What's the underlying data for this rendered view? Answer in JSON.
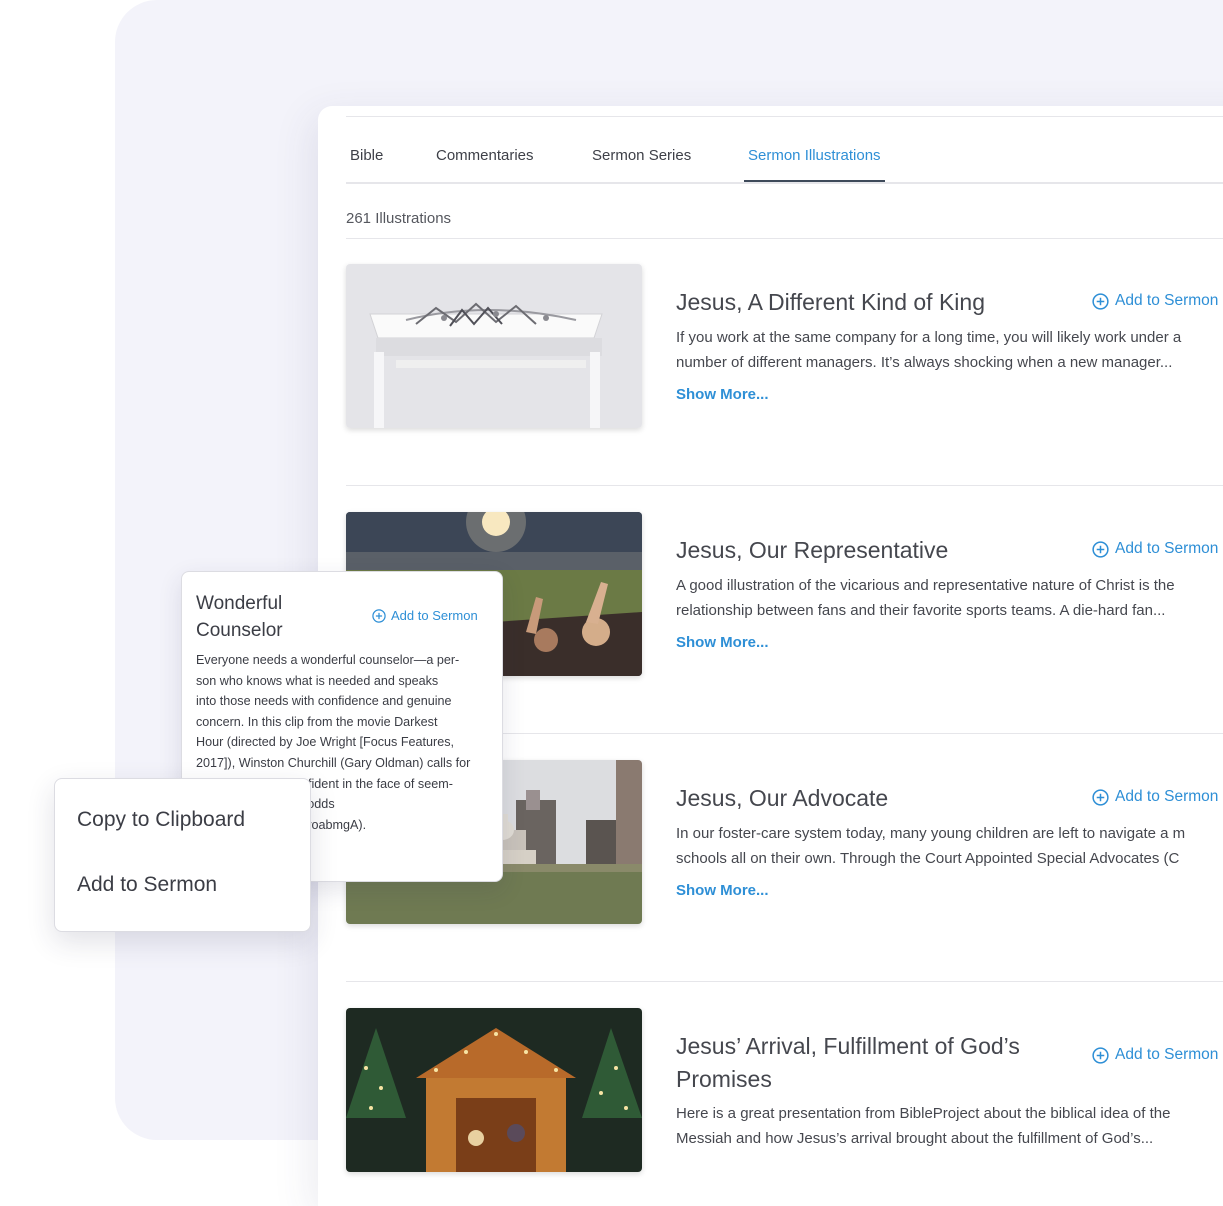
{
  "tabs": [
    {
      "label": "Bible"
    },
    {
      "label": "Commentaries"
    },
    {
      "label": "Sermon Series"
    },
    {
      "label": "Sermon Illustrations",
      "active": true
    }
  ],
  "count_label": "261 Illustrations",
  "colors": {
    "accent": "#2e8fd6",
    "text": "#45474e",
    "background_panel": "#f3f3fa"
  },
  "items": [
    {
      "title": "Jesus, A Different Kind of King",
      "add_label": "Add to Sermon",
      "desc_line1": "If you work at the same company for a long time, you will likely work under a",
      "desc_line2": "number of different managers. It’s always shocking when a new manager...",
      "more": "Show More...",
      "image": "crown-on-white-stand"
    },
    {
      "title": "Jesus, Our Representative",
      "add_label": "Add to Sermon",
      "desc_line1": "A good illustration of the vicarious and representative nature of Christ is the",
      "desc_line2": "relationship between fans and their favorite sports teams. A die-hard fan...",
      "more": "Show More...",
      "image": "stadium-crowd"
    },
    {
      "title": "Jesus, Our Advocate",
      "add_label": "Add to Sermon",
      "desc_line1": "In our foster-care system today, many young children are left to navigate a m",
      "desc_line2": "schools all on their own. Through the Court Appointed Special Advocates (C",
      "more": "Show More...",
      "image": "city-courthouse"
    },
    {
      "title_line1": "Jesus’ Arrival, Fulfillment of God’s",
      "title_line2": "Promises",
      "add_label": "Add to Sermon",
      "desc_line1": "Here is a great presentation from BibleProject about the biblical idea of the",
      "desc_line2": "Messiah and how Jesus’s arrival brought about the fulfillment of God’s...",
      "image": "nativity-scene"
    }
  ],
  "popover": {
    "title_line1": "Wonderful",
    "title_line2": "Counselor",
    "add_label": "Add to Sermon",
    "lines": [
      "Everyone needs a wonderful counselor—a per-",
      "son who knows what is needed and speaks",
      "into those needs with confidence and genuine",
      "concern. In this clip from the movie Darkest",
      "Hour (directed by Joe Wright [Focus Features,",
      "2017]), Winston Churchill (Gary Oldman) calls for",
      "onfident in the face of seem-",
      "le odds",
      "rdyoabmgA)."
    ]
  },
  "context_menu": {
    "items": [
      "Copy to Clipboard",
      "Add to Sermon"
    ]
  }
}
